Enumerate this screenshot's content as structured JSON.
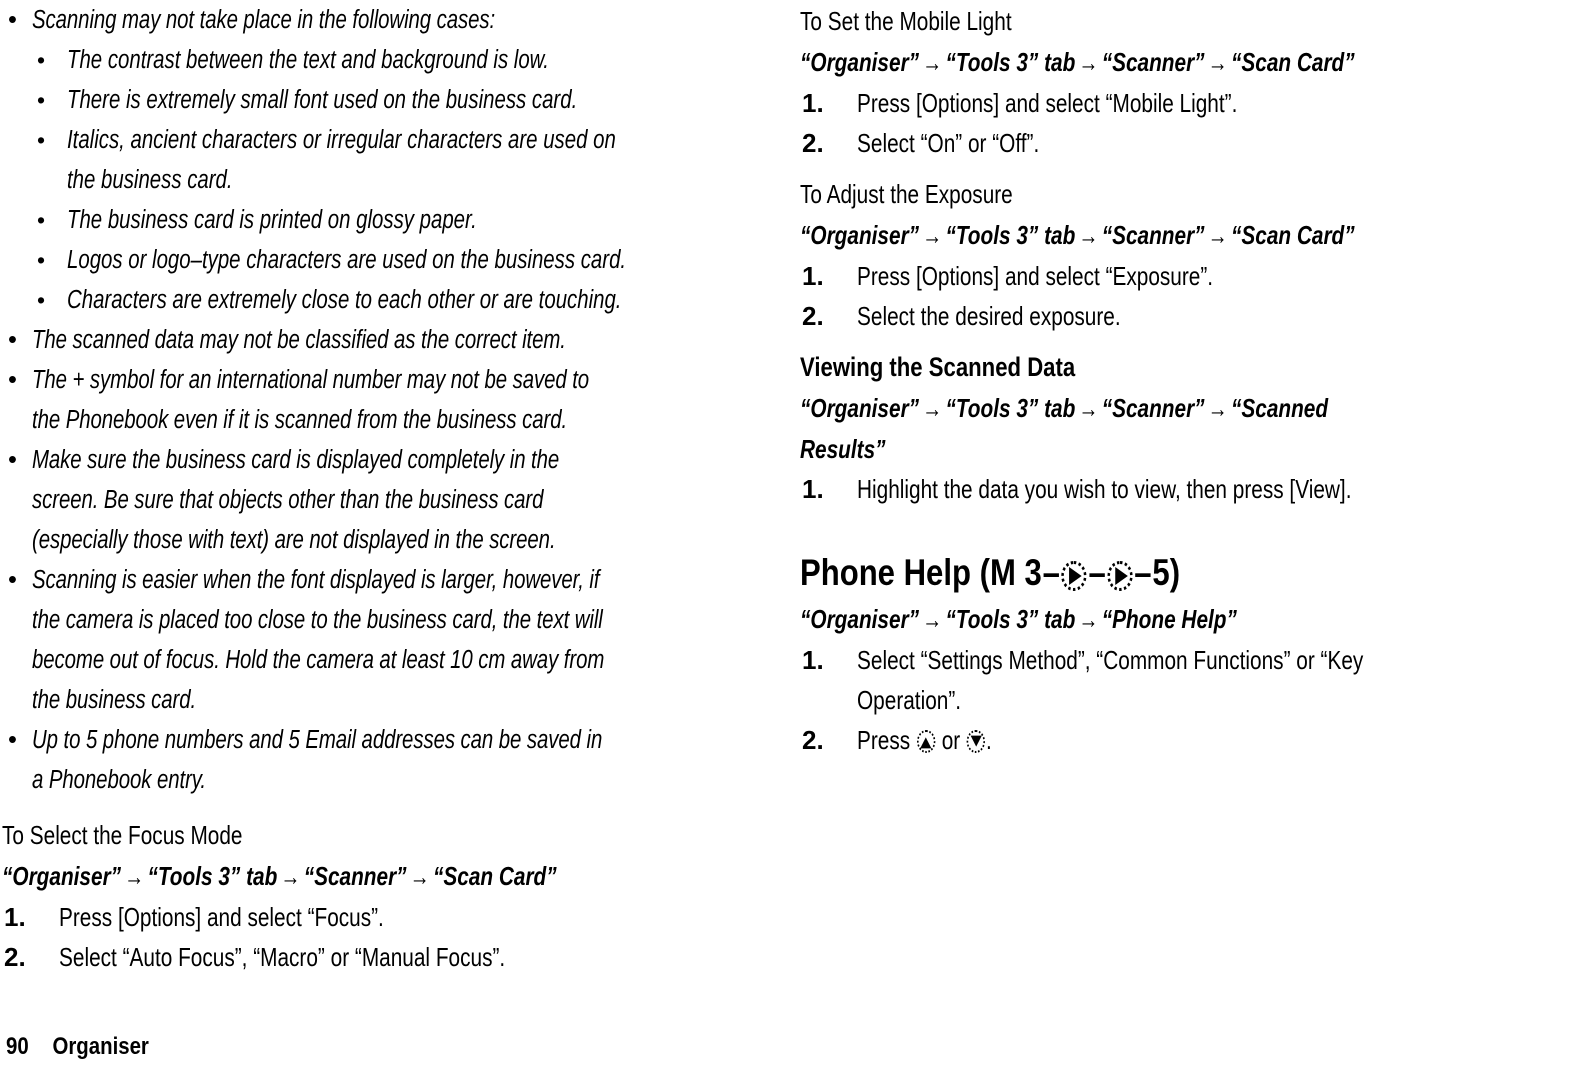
{
  "page": {
    "number": "90",
    "chapter": "Organiser"
  },
  "left_column": {
    "notes": [
      {
        "text": "Scanning may not take place in the following cases:",
        "sub_items": [
          "The contrast between the text and background is low.",
          "There is extremely small font used on the business card.",
          "Italics, ancient characters or irregular characters are used on\nthe business card.",
          "The business card is printed on glossy paper.",
          "Logos or logo–type characters are used on the business card.",
          "Characters are extremely close to each other or are touching."
        ]
      },
      {
        "text": "The scanned data may not be classified as the correct item.",
        "sub_items": []
      },
      {
        "text": "The + symbol for an international number may not be saved to\nthe Phonebook even if it is scanned from the business card.",
        "sub_items": []
      },
      {
        "text": "Make sure the business card is displayed completely in the\nscreen. Be sure that objects other than the business card\n(especially those with text) are not displayed in the screen.",
        "sub_items": []
      },
      {
        "text": "Scanning is easier when the font displayed is larger, however, if\nthe camera is placed too close to the business card, the text will\nbecome out of focus. Hold the camera at least 10 cm away from\nthe business card.",
        "sub_items": []
      },
      {
        "text": "Up to 5 phone numbers and 5 Email addresses can be saved in\na Phonebook entry.",
        "sub_items": []
      }
    ],
    "focus_section": {
      "subhead": "To Select the Focus Mode",
      "path": [
        "“Organiser”",
        "“Tools 3” tab",
        "“Scanner”",
        "“Scan Card”"
      ],
      "steps": [
        {
          "num": "1.",
          "text": "Press [Options] and select “Focus”."
        },
        {
          "num": "2.",
          "text": "Select “Auto Focus”, “Macro” or “Manual Focus”."
        }
      ]
    }
  },
  "right_column": {
    "mobile_light_section": {
      "subhead": "To Set the Mobile Light",
      "path": [
        "“Organiser”",
        "“Tools 3” tab",
        "“Scanner”",
        "“Scan Card”"
      ],
      "steps": [
        {
          "num": "1.",
          "text": "Press [Options] and select “Mobile Light”."
        },
        {
          "num": "2.",
          "text": "Select “On” or “Off”."
        }
      ]
    },
    "exposure_section": {
      "subhead": "To Adjust the Exposure",
      "path": [
        "“Organiser”",
        "“Tools 3” tab",
        "“Scanner”",
        "“Scan Card”"
      ],
      "steps": [
        {
          "num": "1.",
          "text": "Press [Options] and select “Exposure”."
        },
        {
          "num": "2.",
          "text": "Select the desired exposure."
        }
      ]
    },
    "viewing_section": {
      "heading": "Viewing the Scanned Data",
      "path": [
        "“Organiser”",
        "“Tools 3” tab",
        "“Scanner”",
        "“Scanned"
      ],
      "path_tail": "Results”",
      "steps": [
        {
          "num": "1.",
          "text": "Highlight the data you wish to view, then press [View]."
        }
      ]
    },
    "phone_help_section": {
      "heading_prefix": "Phone Help (M 3",
      "heading_suffix": "5)",
      "heading_dash": "–",
      "path": [
        "“Organiser”",
        "“Tools 3” tab",
        "“Phone Help”"
      ],
      "steps": [
        {
          "num": "1.",
          "text": "Select “Settings Method”, “Common Functions” or “Key\nOperation”."
        },
        {
          "num": "2.",
          "text_before": "Press ",
          "text_middle": " or ",
          "text_after": "."
        }
      ]
    }
  },
  "symbols": {
    "arrow": "→",
    "bullet": "•",
    "nav_right_key": "nav-right-key-icon",
    "nav_up_key": "nav-up-key-icon",
    "nav_down_key": "nav-down-key-icon"
  }
}
